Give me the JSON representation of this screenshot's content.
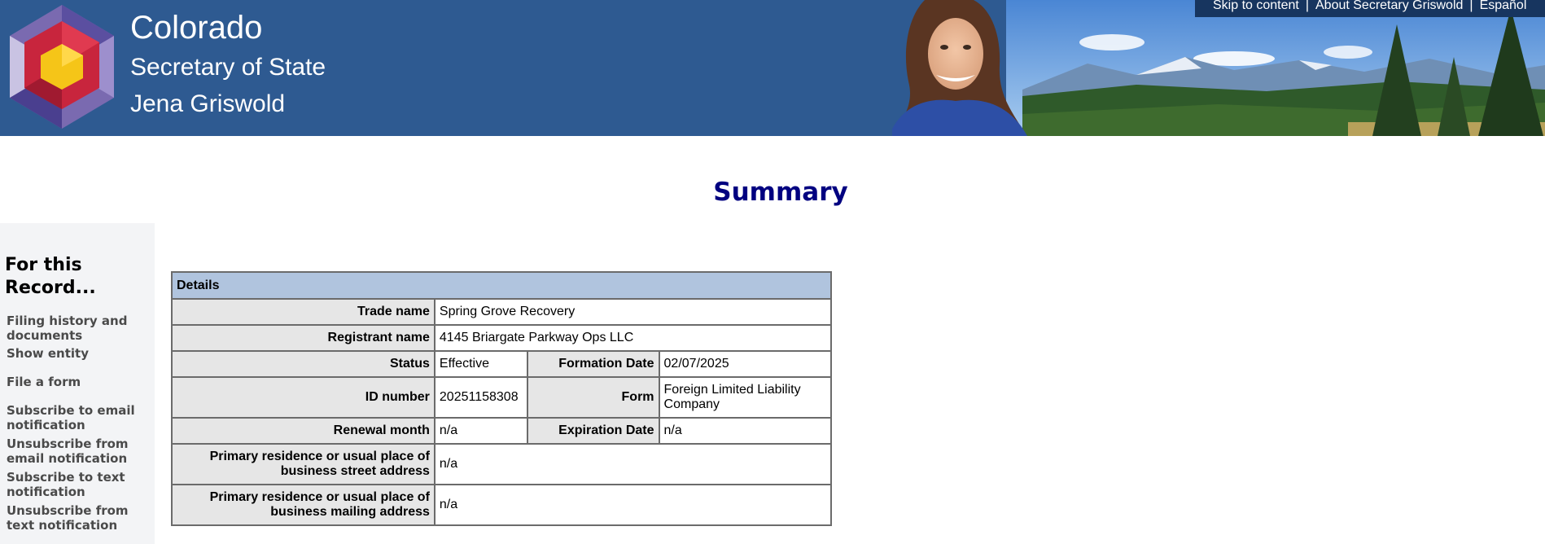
{
  "header": {
    "state": "Colorado",
    "office": "Secretary of State",
    "person": "Jena Griswold",
    "utility_links": [
      "Skip to content",
      "About Secretary Griswold",
      "Español"
    ]
  },
  "page": {
    "title": "Summary"
  },
  "sidebar": {
    "heading": "For this Record...",
    "links": [
      "Filing history and documents",
      "Show entity",
      "File a form",
      "Subscribe to email notification",
      "Unsubscribe from email notification",
      "Subscribe to text notification",
      "Unsubscribe from text notification"
    ]
  },
  "details": {
    "caption": "Details",
    "trade_name_label": "Trade name",
    "trade_name": "Spring Grove Recovery",
    "registrant_label": "Registrant name",
    "registrant": "4145 Briargate Parkway Ops LLC",
    "status_label": "Status",
    "status": "Effective",
    "formation_label": "Formation Date",
    "formation": "02/07/2025",
    "id_label": "ID number",
    "id": "20251158308",
    "form_label": "Form",
    "form": "Foreign Limited Liability Company",
    "renewal_label": "Renewal month",
    "renewal": "n/a",
    "expiration_label": "Expiration Date",
    "expiration": "n/a",
    "street_label": "Primary residence or usual place of business street address",
    "street": "n/a",
    "mailing_label": "Primary residence or usual place of business mailing address",
    "mailing": "n/a"
  },
  "colors": {
    "banner": "#2e5a91",
    "utility_bar": "#17355f",
    "title": "#000080",
    "table_caption": "#b0c4de",
    "label_cell": "#e6e6e6"
  }
}
